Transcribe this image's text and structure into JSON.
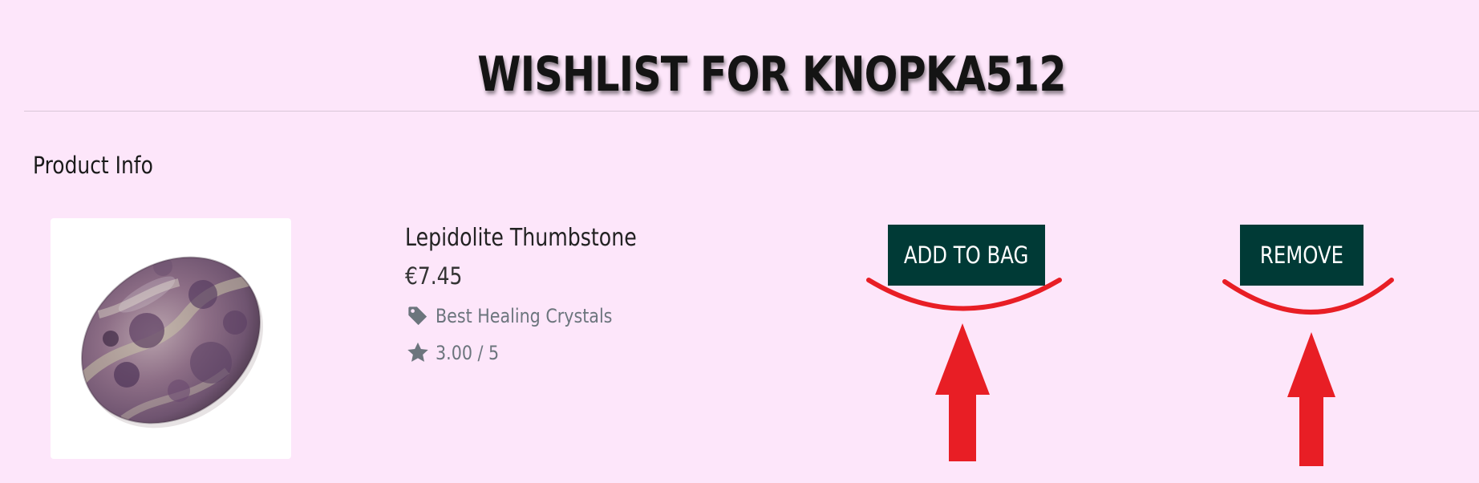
{
  "page": {
    "title": "WISHLIST FOR KNOPKA512"
  },
  "section": {
    "label": "Product Info"
  },
  "product": {
    "name": "Lepidolite Thumbstone",
    "price": "€7.45",
    "category": "Best Healing Crystals",
    "category_icon": "tag-icon",
    "rating": "3.00 / 5",
    "rating_icon": "star-icon",
    "image": "lepidolite-thumbstone-photo"
  },
  "actions": {
    "add_to_bag_label": "ADD TO BAG",
    "remove_label": "REMOVE"
  },
  "colors": {
    "background": "#fde6fa",
    "button": "#003a36",
    "button_text": "#ffffff",
    "muted_text": "#6c757d",
    "annotation": "#e81e25"
  }
}
